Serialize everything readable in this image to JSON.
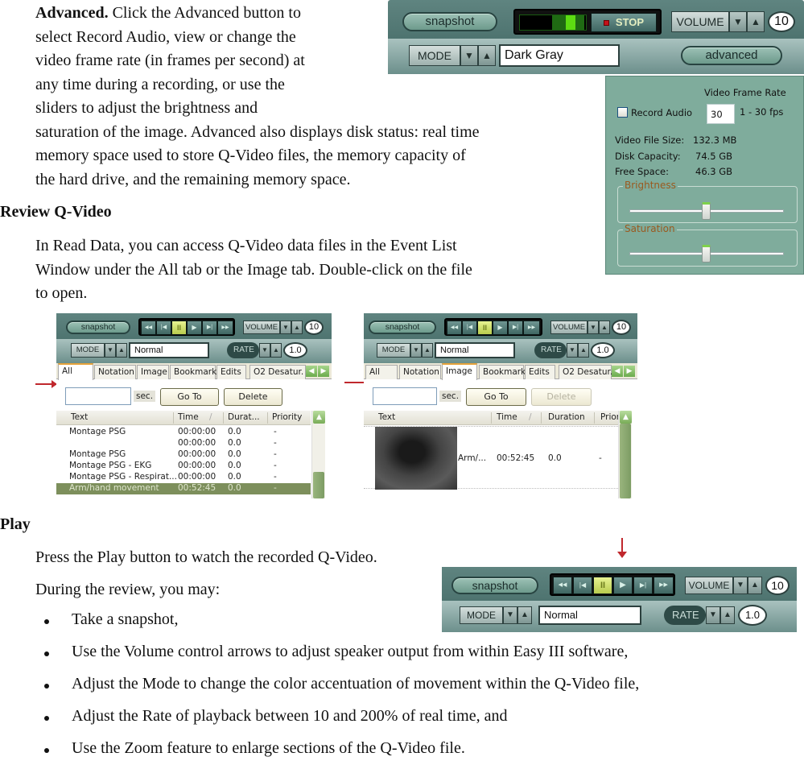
{
  "doc": {
    "advanced_para": {
      "lead": "Advanced.",
      "lines": [
        " Click the Advanced button to",
        "select Record Audio, view or change the",
        "video frame rate (in frames per second) at",
        "any time during a recording, or use the",
        "sliders to adjust the brightness and",
        "saturation of the image. Advanced also displays disk status: real time",
        "memory space used to store Q-Video files, the memory capacity of",
        "the hard drive, and the remaining memory space."
      ]
    },
    "review_heading": "Review Q-Video",
    "review_para": [
      "In Read Data, you can access Q-Video data files in the Event List",
      "Window under the All tab or the Image tab. Double-click on the file",
      "to open."
    ],
    "play_heading": "Play",
    "play_para": "Press the Play button to watch the recorded Q-Video.",
    "during_para": "During the review, you may:",
    "bullets": [
      "Take a snapshot,",
      "Use the Volume control arrows to adjust speaker output from within Easy III software,",
      "Adjust the Mode to change the color accentuation of movement within the Q-Video file,",
      "Adjust the Rate of playback between 10 and 200% of real time, and",
      "Use the Zoom feature to enlarge sections of the Q-Video file."
    ]
  },
  "record_toolbar": {
    "snapshot_label": "snapshot",
    "stop_label": "STOP",
    "volume_label": "VOLUME",
    "volume_value": "10",
    "mode_label": "MODE",
    "mode_value": "Dark Gray",
    "advanced_label": "advanced",
    "down_arrow": "▼",
    "up_arrow": "▲"
  },
  "advanced_panel": {
    "frame_rate_title": "Video Frame Rate",
    "record_audio_label": "Record Audio",
    "record_audio_checked": false,
    "frame_rate_value": "30",
    "frame_rate_range": "1 - 30 fps",
    "file_size_label": "Video File Size:",
    "file_size_value": "132.3 MB",
    "disk_capacity_label": "Disk Capacity:",
    "disk_capacity_value": "74.5 GB",
    "free_space_label": "Free Space:",
    "free_space_value": "46.3 GB",
    "brightness_label": "Brightness",
    "brightness_level": 0.5,
    "saturation_label": "Saturation",
    "saturation_level": 0.5
  },
  "playback_toolbar": {
    "snapshot_label": "snapshot",
    "rewind": "◀◀",
    "prev": "|◀",
    "pause": "II",
    "play": "▶",
    "next": "▶|",
    "forward": "▶▶",
    "volume_label": "VOLUME",
    "volume_value": "10",
    "mode_label": "MODE",
    "mode_value": "Normal",
    "rate_label": "RATE",
    "rate_value": "1.0",
    "down_arrow": "▼",
    "up_arrow": "▲"
  },
  "event_list_all": {
    "tabs": [
      "All",
      "Notation",
      "Image",
      "Bookmark",
      "Edits",
      "O2 Desatur."
    ],
    "active_tab": "All",
    "sec_label": "sec.",
    "goto_label": "Go To",
    "delete_label": "Delete",
    "columns": [
      "Text",
      "Time",
      "Durat...",
      "Priority"
    ],
    "rows": [
      {
        "text": "Montage PSG",
        "time": "00:00:00",
        "duration": "0.0",
        "priority": "-"
      },
      {
        "text": "",
        "time": "00:00:00",
        "duration": "0.0",
        "priority": "-"
      },
      {
        "text": "Montage PSG",
        "time": "00:00:00",
        "duration": "0.0",
        "priority": "-"
      },
      {
        "text": "Montage PSG - EKG",
        "time": "00:00:00",
        "duration": "0.0",
        "priority": "-"
      },
      {
        "text": "Montage PSG - Respirat...",
        "time": "00:00:00",
        "duration": "0.0",
        "priority": "-"
      },
      {
        "text": "Arm/hand movement",
        "time": "00:52:45",
        "duration": "0.0",
        "priority": "-"
      }
    ]
  },
  "event_list_image": {
    "tabs": [
      "All",
      "Notation",
      "Image",
      "Bookmark",
      "Edits",
      "O2 Desatur."
    ],
    "active_tab": "Image",
    "sec_label": "sec.",
    "goto_label": "Go To",
    "delete_label": "Delete",
    "columns": [
      "Text",
      "Time",
      "Duration",
      "Prior"
    ],
    "rows": [
      {
        "text": "Arm/...",
        "time": "00:52:45",
        "duration": "0.0",
        "priority": "-"
      }
    ]
  },
  "colors": {
    "toolbar_teal": "#4f7571",
    "panel_green": "#7fac9c",
    "arrow_red": "#c0282d",
    "selected_row": "#7d8f5c",
    "brightness_title": "#9a5a1f"
  }
}
